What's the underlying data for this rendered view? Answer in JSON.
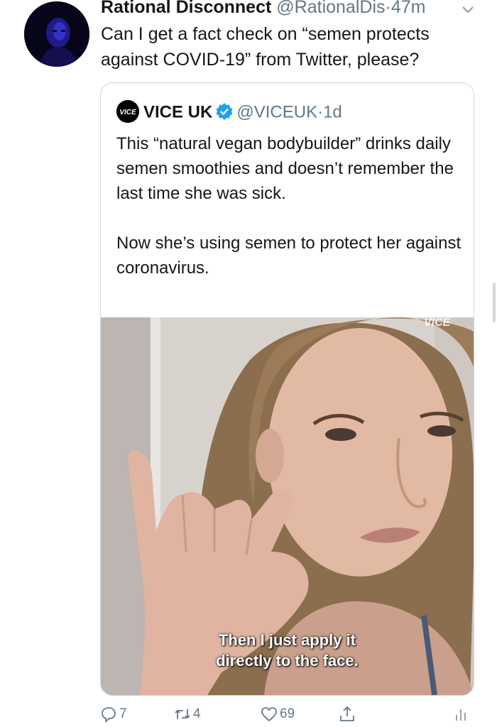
{
  "tweet": {
    "display_name": "Rational Disconnect",
    "handle": "@RationalDis",
    "separator": "·",
    "time": "47m",
    "text": "Can I get a fact check on “semen protects against COVID-19” from Twitter, please?",
    "avatar_icon": "user-avatar"
  },
  "quoted": {
    "logo_text": "VICE",
    "display_name": "VICE UK",
    "verified_icon": "verified-badge-icon",
    "handle": "@VICEUK",
    "separator": "·",
    "time": "1d",
    "paragraphs": [
      "This “natural vegan bodybuilder” drinks daily semen smoothies and doesn’t remember the last time she was sick.",
      "Now she’s using semen to protect her against coronavirus."
    ],
    "media": {
      "caption_line1": "Then I just apply it",
      "caption_line2": "directly to the face.",
      "watermark": "VICE"
    }
  },
  "actions": {
    "reply_count": "7",
    "retweet_count": "4",
    "like_count": "69"
  },
  "colors": {
    "secondary_text": "#657786",
    "verified_blue": "#1da1f2",
    "border": "#ccd6dd"
  }
}
